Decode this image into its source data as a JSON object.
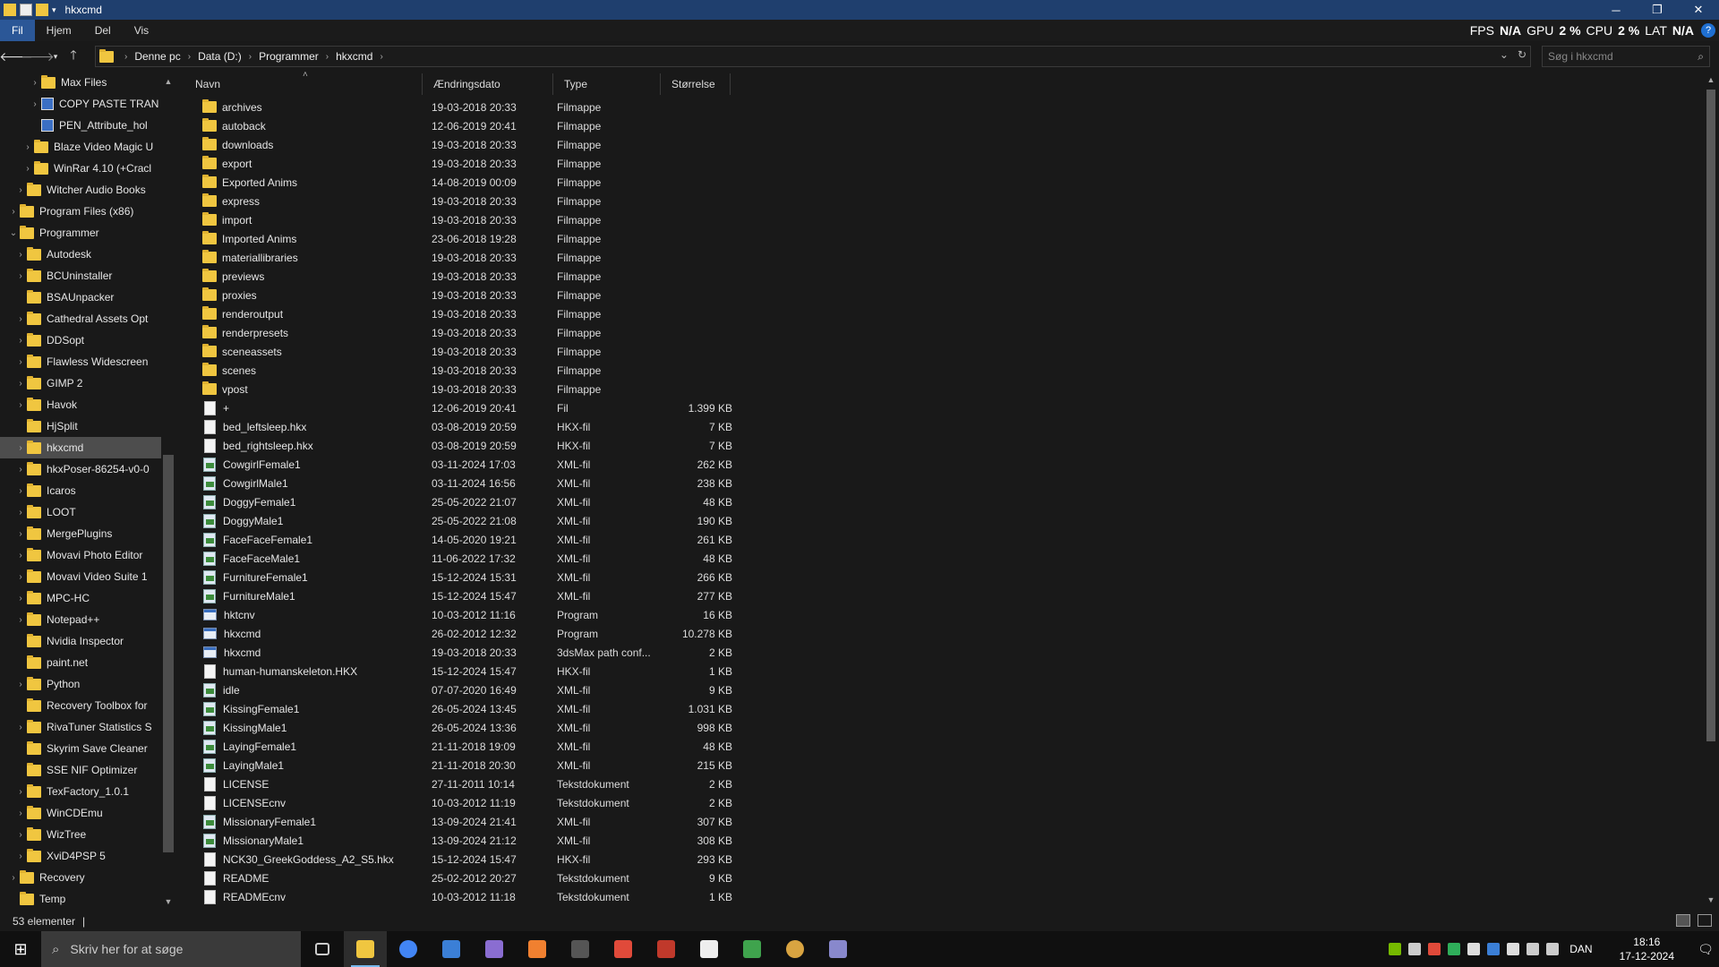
{
  "window": {
    "title": "hkxcmd",
    "controls": {
      "minimize": "─",
      "restore": "❐",
      "close": "✕"
    }
  },
  "ribbon": {
    "tabs": [
      "Fil",
      "Hjem",
      "Del",
      "Vis"
    ],
    "active": "Fil"
  },
  "osd": {
    "fps_label": "FPS",
    "fps_value": "N/A",
    "gpu_label": "GPU",
    "gpu_value": "2 %",
    "cpu_label": "CPU",
    "cpu_value": "2 %",
    "lat_label": "LAT",
    "lat_value": "N/A"
  },
  "address": {
    "crumbs": [
      "Denne pc",
      "Data (D:)",
      "Programmer",
      "hkxcmd"
    ]
  },
  "search": {
    "placeholder": "Søg i hkxcmd"
  },
  "tree": [
    {
      "label": "Max Files",
      "indent": 3,
      "expandable": true,
      "icon": "folder"
    },
    {
      "label": "COPY PASTE TRAN",
      "indent": 3,
      "expandable": true,
      "icon": "app"
    },
    {
      "label": "PEN_Attribute_hol",
      "indent": 3,
      "expandable": false,
      "icon": "app"
    },
    {
      "label": "Blaze Video Magic U",
      "indent": 2,
      "expandable": true,
      "icon": "folder"
    },
    {
      "label": "WinRar 4.10 (+Cracl",
      "indent": 2,
      "expandable": true,
      "icon": "folder"
    },
    {
      "label": "Witcher Audio Books",
      "indent": 1,
      "expandable": true,
      "icon": "folder"
    },
    {
      "label": "Program Files (x86)",
      "indent": 0,
      "expandable": true,
      "icon": "folder"
    },
    {
      "label": "Programmer",
      "indent": 0,
      "expandable": true,
      "expanded": true,
      "icon": "folder"
    },
    {
      "label": "Autodesk",
      "indent": 1,
      "expandable": true,
      "icon": "folder"
    },
    {
      "label": "BCUninstaller",
      "indent": 1,
      "expandable": true,
      "icon": "folder"
    },
    {
      "label": "BSAUnpacker",
      "indent": 1,
      "expandable": false,
      "icon": "folder"
    },
    {
      "label": "Cathedral Assets Opt",
      "indent": 1,
      "expandable": true,
      "icon": "folder"
    },
    {
      "label": "DDSopt",
      "indent": 1,
      "expandable": true,
      "icon": "folder"
    },
    {
      "label": "Flawless Widescreen",
      "indent": 1,
      "expandable": true,
      "icon": "folder"
    },
    {
      "label": "GIMP 2",
      "indent": 1,
      "expandable": true,
      "icon": "folder"
    },
    {
      "label": "Havok",
      "indent": 1,
      "expandable": true,
      "icon": "folder"
    },
    {
      "label": "HjSplit",
      "indent": 1,
      "expandable": false,
      "icon": "folder"
    },
    {
      "label": "hkxcmd",
      "indent": 1,
      "expandable": true,
      "icon": "folder",
      "selected": true
    },
    {
      "label": "hkxPoser-86254-v0-0",
      "indent": 1,
      "expandable": true,
      "icon": "folder"
    },
    {
      "label": "Icaros",
      "indent": 1,
      "expandable": true,
      "icon": "folder"
    },
    {
      "label": "LOOT",
      "indent": 1,
      "expandable": true,
      "icon": "folder"
    },
    {
      "label": "MergePlugins",
      "indent": 1,
      "expandable": true,
      "icon": "folder"
    },
    {
      "label": "Movavi Photo Editor",
      "indent": 1,
      "expandable": true,
      "icon": "folder"
    },
    {
      "label": "Movavi Video Suite 1",
      "indent": 1,
      "expandable": true,
      "icon": "folder"
    },
    {
      "label": "MPC-HC",
      "indent": 1,
      "expandable": true,
      "icon": "folder"
    },
    {
      "label": "Notepad++",
      "indent": 1,
      "expandable": true,
      "icon": "folder"
    },
    {
      "label": "Nvidia Inspector",
      "indent": 1,
      "expandable": false,
      "icon": "folder"
    },
    {
      "label": "paint.net",
      "indent": 1,
      "expandable": false,
      "icon": "folder"
    },
    {
      "label": "Python",
      "indent": 1,
      "expandable": true,
      "icon": "folder"
    },
    {
      "label": "Recovery Toolbox for",
      "indent": 1,
      "expandable": false,
      "icon": "folder"
    },
    {
      "label": "RivaTuner Statistics S",
      "indent": 1,
      "expandable": true,
      "icon": "folder"
    },
    {
      "label": "Skyrim Save Cleaner",
      "indent": 1,
      "expandable": false,
      "icon": "folder"
    },
    {
      "label": "SSE NIF Optimizer",
      "indent": 1,
      "expandable": false,
      "icon": "folder"
    },
    {
      "label": "TexFactory_1.0.1",
      "indent": 1,
      "expandable": true,
      "icon": "folder"
    },
    {
      "label": "WinCDEmu",
      "indent": 1,
      "expandable": true,
      "icon": "folder"
    },
    {
      "label": "WizTree",
      "indent": 1,
      "expandable": true,
      "icon": "folder"
    },
    {
      "label": "XviD4PSP 5",
      "indent": 1,
      "expandable": true,
      "icon": "folder"
    },
    {
      "label": "Recovery",
      "indent": 0,
      "expandable": true,
      "icon": "folder"
    },
    {
      "label": "Temp",
      "indent": 0,
      "expandable": false,
      "icon": "folder"
    }
  ],
  "columns": [
    "Navn",
    "Ændringsdato",
    "Type",
    "Størrelse"
  ],
  "files": [
    {
      "name": "archives",
      "date": "19-03-2018 20:33",
      "type": "Filmappe",
      "size": "",
      "icon": "folder"
    },
    {
      "name": "autoback",
      "date": "12-06-2019 20:41",
      "type": "Filmappe",
      "size": "",
      "icon": "folder"
    },
    {
      "name": "downloads",
      "date": "19-03-2018 20:33",
      "type": "Filmappe",
      "size": "",
      "icon": "folder"
    },
    {
      "name": "export",
      "date": "19-03-2018 20:33",
      "type": "Filmappe",
      "size": "",
      "icon": "folder"
    },
    {
      "name": "Exported Anims",
      "date": "14-08-2019 00:09",
      "type": "Filmappe",
      "size": "",
      "icon": "folder"
    },
    {
      "name": "express",
      "date": "19-03-2018 20:33",
      "type": "Filmappe",
      "size": "",
      "icon": "folder"
    },
    {
      "name": "import",
      "date": "19-03-2018 20:33",
      "type": "Filmappe",
      "size": "",
      "icon": "folder"
    },
    {
      "name": "Imported Anims",
      "date": "23-06-2018 19:28",
      "type": "Filmappe",
      "size": "",
      "icon": "folder"
    },
    {
      "name": "materiallibraries",
      "date": "19-03-2018 20:33",
      "type": "Filmappe",
      "size": "",
      "icon": "folder"
    },
    {
      "name": "previews",
      "date": "19-03-2018 20:33",
      "type": "Filmappe",
      "size": "",
      "icon": "folder"
    },
    {
      "name": "proxies",
      "date": "19-03-2018 20:33",
      "type": "Filmappe",
      "size": "",
      "icon": "folder"
    },
    {
      "name": "renderoutput",
      "date": "19-03-2018 20:33",
      "type": "Filmappe",
      "size": "",
      "icon": "folder"
    },
    {
      "name": "renderpresets",
      "date": "19-03-2018 20:33",
      "type": "Filmappe",
      "size": "",
      "icon": "folder"
    },
    {
      "name": "sceneassets",
      "date": "19-03-2018 20:33",
      "type": "Filmappe",
      "size": "",
      "icon": "folder"
    },
    {
      "name": "scenes",
      "date": "19-03-2018 20:33",
      "type": "Filmappe",
      "size": "",
      "icon": "folder"
    },
    {
      "name": "vpost",
      "date": "19-03-2018 20:33",
      "type": "Filmappe",
      "size": "",
      "icon": "folder"
    },
    {
      "name": "+",
      "date": "12-06-2019 20:41",
      "type": "Fil",
      "size": "1.399 KB",
      "icon": "file"
    },
    {
      "name": "bed_leftsleep.hkx",
      "date": "03-08-2019 20:59",
      "type": "HKX-fil",
      "size": "7 KB",
      "icon": "file"
    },
    {
      "name": "bed_rightsleep.hkx",
      "date": "03-08-2019 20:59",
      "type": "HKX-fil",
      "size": "7 KB",
      "icon": "file"
    },
    {
      "name": "CowgirlFemale1",
      "date": "03-11-2024 17:03",
      "type": "XML-fil",
      "size": "262 KB",
      "icon": "xml"
    },
    {
      "name": "CowgirlMale1",
      "date": "03-11-2024 16:56",
      "type": "XML-fil",
      "size": "238 KB",
      "icon": "xml"
    },
    {
      "name": "DoggyFemale1",
      "date": "25-05-2022 21:07",
      "type": "XML-fil",
      "size": "48 KB",
      "icon": "xml"
    },
    {
      "name": "DoggyMale1",
      "date": "25-05-2022 21:08",
      "type": "XML-fil",
      "size": "190 KB",
      "icon": "xml"
    },
    {
      "name": "FaceFaceFemale1",
      "date": "14-05-2020 19:21",
      "type": "XML-fil",
      "size": "261 KB",
      "icon": "xml"
    },
    {
      "name": "FaceFaceMale1",
      "date": "11-06-2022 17:32",
      "type": "XML-fil",
      "size": "48 KB",
      "icon": "xml"
    },
    {
      "name": "FurnitureFemale1",
      "date": "15-12-2024 15:31",
      "type": "XML-fil",
      "size": "266 KB",
      "icon": "xml"
    },
    {
      "name": "FurnitureMale1",
      "date": "15-12-2024 15:47",
      "type": "XML-fil",
      "size": "277 KB",
      "icon": "xml"
    },
    {
      "name": "hktcnv",
      "date": "10-03-2012 11:16",
      "type": "Program",
      "size": "16 KB",
      "icon": "exe"
    },
    {
      "name": "hkxcmd",
      "date": "26-02-2012 12:32",
      "type": "Program",
      "size": "10.278 KB",
      "icon": "exe"
    },
    {
      "name": "hkxcmd",
      "date": "19-03-2018 20:33",
      "type": "3dsMax path conf...",
      "size": "2 KB",
      "icon": "exe"
    },
    {
      "name": "human-humanskeleton.HKX",
      "date": "15-12-2024 15:47",
      "type": "HKX-fil",
      "size": "1 KB",
      "icon": "file"
    },
    {
      "name": "idle",
      "date": "07-07-2020 16:49",
      "type": "XML-fil",
      "size": "9 KB",
      "icon": "xml"
    },
    {
      "name": "KissingFemale1",
      "date": "26-05-2024 13:45",
      "type": "XML-fil",
      "size": "1.031 KB",
      "icon": "xml"
    },
    {
      "name": "KissingMale1",
      "date": "26-05-2024 13:36",
      "type": "XML-fil",
      "size": "998 KB",
      "icon": "xml"
    },
    {
      "name": "LayingFemale1",
      "date": "21-11-2018 19:09",
      "type": "XML-fil",
      "size": "48 KB",
      "icon": "xml"
    },
    {
      "name": "LayingMale1",
      "date": "21-11-2018 20:30",
      "type": "XML-fil",
      "size": "215 KB",
      "icon": "xml"
    },
    {
      "name": "LICENSE",
      "date": "27-11-2011 10:14",
      "type": "Tekstdokument",
      "size": "2 KB",
      "icon": "file"
    },
    {
      "name": "LICENSEcnv",
      "date": "10-03-2012 11:19",
      "type": "Tekstdokument",
      "size": "2 KB",
      "icon": "file"
    },
    {
      "name": "MissionaryFemale1",
      "date": "13-09-2024 21:41",
      "type": "XML-fil",
      "size": "307 KB",
      "icon": "xml"
    },
    {
      "name": "MissionaryMale1",
      "date": "13-09-2024 21:12",
      "type": "XML-fil",
      "size": "308 KB",
      "icon": "xml"
    },
    {
      "name": "NCK30_GreekGoddess_A2_S5.hkx",
      "date": "15-12-2024 15:47",
      "type": "HKX-fil",
      "size": "293 KB",
      "icon": "file"
    },
    {
      "name": "README",
      "date": "25-02-2012 20:27",
      "type": "Tekstdokument",
      "size": "9 KB",
      "icon": "file"
    },
    {
      "name": "READMEcnv",
      "date": "10-03-2012 11:18",
      "type": "Tekstdokument",
      "size": "1 KB",
      "icon": "file"
    }
  ],
  "status": {
    "count": "53 elementer",
    "sep": "|"
  },
  "taskbar": {
    "search_placeholder": "Skriv her for at søge",
    "apps": [
      {
        "name": "task-view",
        "color": "#cccccc"
      },
      {
        "name": "file-explorer",
        "color": "#f0c640",
        "active": true
      },
      {
        "name": "chrome",
        "color": "#4285f4"
      },
      {
        "name": "app-window",
        "color": "#3b7fd6"
      },
      {
        "name": "visual-studio",
        "color": "#8a6dd1"
      },
      {
        "name": "blender-like",
        "color": "#f08030"
      },
      {
        "name": "app-terminal",
        "color": "#555555"
      },
      {
        "name": "paint",
        "color": "#e04a3a"
      },
      {
        "name": "pen-app",
        "color": "#c0392b"
      },
      {
        "name": "clapper-app",
        "color": "#eeeeee"
      },
      {
        "name": "green-app",
        "color": "#3fa34d"
      },
      {
        "name": "orb-app",
        "color": "#d9a441"
      },
      {
        "name": "rivatuner",
        "color": "#8888cc"
      }
    ],
    "language": "DAN",
    "time": "18:16",
    "date": "17-12-2024"
  }
}
